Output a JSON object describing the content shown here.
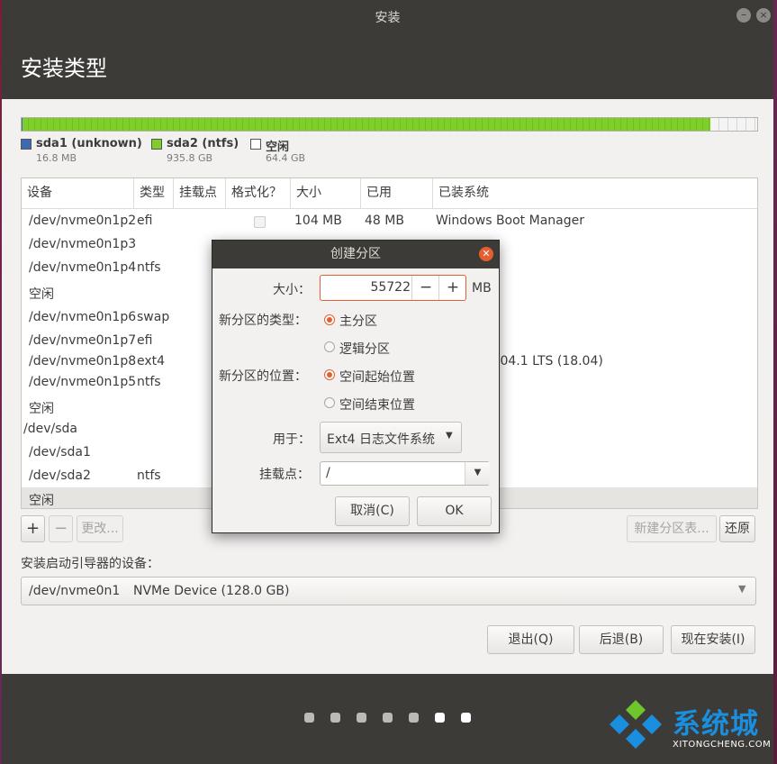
{
  "window": {
    "title": "安装",
    "minimize_icon": "minimize-icon",
    "close_icon": "close-icon"
  },
  "page": {
    "title": "安装类型"
  },
  "partition_bar": {
    "segments": [
      {
        "name": "sda1 (unknown)",
        "size": "16.8 MB",
        "color": "#3d6bb3",
        "fraction": 0.0002
      },
      {
        "name": "sda2 (ntfs)",
        "size": "935.8 GB",
        "color": "#7fcf2a",
        "fraction": 0.935
      },
      {
        "name": "空闲",
        "size": "64.4 GB",
        "color": "#ffffff",
        "fraction": 0.065
      }
    ]
  },
  "table": {
    "headers": [
      "设备",
      "类型",
      "挂载点",
      "格式化？",
      "大小",
      "已用",
      "已装系统"
    ],
    "rows": [
      {
        "device": "/dev/nvme0n1p2",
        "type": "efi",
        "mount": "",
        "format": "checkbox",
        "size": "104 MB",
        "used": "48 MB",
        "system": "Windows Boot Manager"
      },
      {
        "device": "/dev/nvme0n1p3",
        "type": "",
        "mount": "",
        "format": "",
        "size": "",
        "used": "",
        "system": ""
      },
      {
        "device": "/dev/nvme0n1p4",
        "type": "ntfs",
        "mount": "",
        "format": "",
        "size": "",
        "used": "",
        "system": ""
      },
      {
        "device": "空闲",
        "type": "",
        "mount": "",
        "format": "",
        "size": "",
        "used": "",
        "system": ""
      },
      {
        "device": "/dev/nvme0n1p6",
        "type": "swap",
        "mount": "",
        "format": "",
        "size": "",
        "used": "",
        "system": ""
      },
      {
        "device": "/dev/nvme0n1p7",
        "type": "efi",
        "mount": "",
        "format": "",
        "size": "",
        "used": "",
        "system": ""
      },
      {
        "device": "/dev/nvme0n1p8",
        "type": "ext4",
        "mount": "",
        "format": "",
        "size": "",
        "used": "",
        "system": ".04.1 LTS (18.04)"
      },
      {
        "device": "/dev/nvme0n1p5",
        "type": "ntfs",
        "mount": "",
        "format": "",
        "size": "",
        "used": "",
        "system": ""
      },
      {
        "device": "空闲",
        "type": "",
        "mount": "",
        "format": "",
        "size": "",
        "used": "",
        "system": ""
      },
      {
        "device": "/dev/sda",
        "type": "",
        "mount": "",
        "format": "",
        "size": "",
        "used": "",
        "system": ""
      },
      {
        "device": "/dev/sda1",
        "type": "",
        "mount": "",
        "format": "",
        "size": "",
        "used": "",
        "system": ""
      },
      {
        "device": "/dev/sda2",
        "type": "ntfs",
        "mount": "",
        "format": "",
        "size": "",
        "used": "",
        "system": ""
      },
      {
        "device": "空闲",
        "type": "",
        "mount": "",
        "format": "",
        "size": "",
        "used": "",
        "system": "",
        "selected": true
      }
    ]
  },
  "table_buttons": {
    "add": "+",
    "remove": "−",
    "change": "更改...",
    "new_table": "新建分区表...",
    "revert": "还原"
  },
  "bootloader": {
    "label": "安装启动引导器的设备：",
    "device": "/dev/nvme0n1",
    "description": "NVMe Device (128.0 GB)"
  },
  "nav_buttons": {
    "quit": "退出(Q)",
    "back": "后退(B)",
    "install": "现在安装(I)"
  },
  "progress_dots": {
    "total": 7,
    "active_index": 5
  },
  "dialog": {
    "title": "创建分区",
    "size_label": "大小：",
    "size_value": "55722",
    "size_unit": "MB",
    "minus": "−",
    "plus": "+",
    "type_label": "新分区的类型：",
    "type_options": [
      {
        "label": "主分区",
        "selected": true
      },
      {
        "label": "逻辑分区",
        "selected": false
      }
    ],
    "location_label": "新分区的位置：",
    "location_options": [
      {
        "label": "空间起始位置",
        "selected": true
      },
      {
        "label": "空间结束位置",
        "selected": false
      }
    ],
    "use_label": "用于：",
    "use_value": "Ext4 日志文件系统",
    "mount_label": "挂载点：",
    "mount_value": "/",
    "cancel": "取消(C)",
    "ok": "OK"
  },
  "watermark": {
    "text": "系统城",
    "sub": "XITONGCHENG.COM"
  },
  "colors": {
    "accent": "#e06032",
    "titlebar": "#3c3b37",
    "ntfs_green": "#7fcf2a",
    "unknown_blue": "#3d6bb3",
    "watermark_blue": "#1a8fdf"
  }
}
